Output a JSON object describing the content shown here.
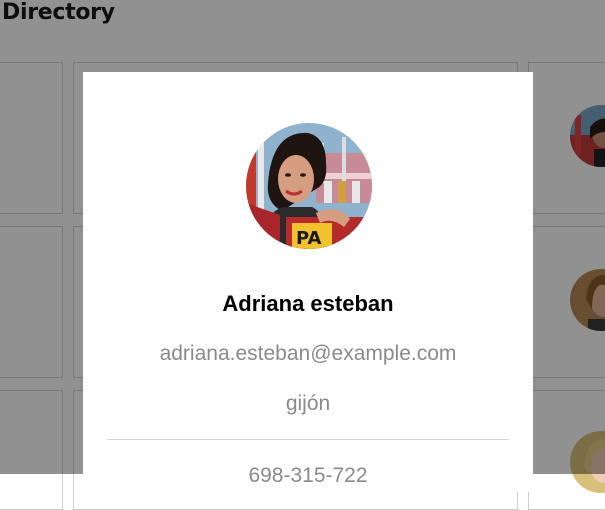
{
  "page": {
    "title": "Directory"
  },
  "modal": {
    "name": "Adriana esteban",
    "email": "adriana.esteban@example.com",
    "city": "gijón",
    "phone": "698-315-722"
  },
  "colors": {
    "overlay": "#000000",
    "secondary_text": "#8a8a8a",
    "card_border": "#cfcfcf"
  }
}
